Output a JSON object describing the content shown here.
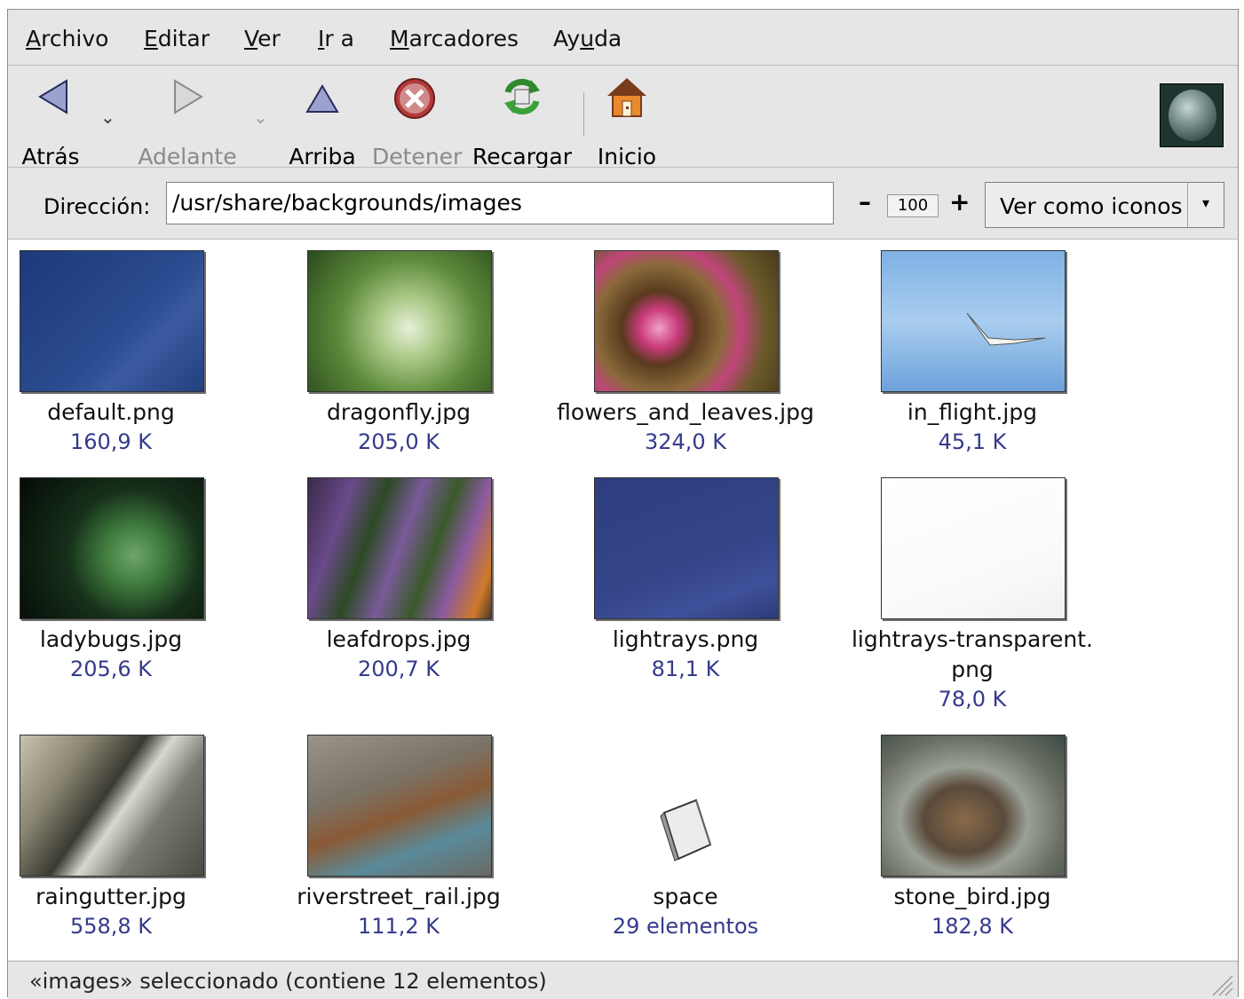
{
  "menu": {
    "items": [
      {
        "pre": "",
        "key": "A",
        "post": "rchivo"
      },
      {
        "pre": "",
        "key": "E",
        "post": "ditar"
      },
      {
        "pre": "",
        "key": "V",
        "post": "er"
      },
      {
        "pre": "",
        "key": "I",
        "post": "r a"
      },
      {
        "pre": "",
        "key": "M",
        "post": "arcadores"
      },
      {
        "pre": "Ay",
        "key": "u",
        "post": "da"
      }
    ]
  },
  "toolbar": {
    "back_label": "Atrás",
    "forward_label": "Adelante",
    "up_label": "Arriba",
    "stop_label": "Detener",
    "reload_label": "Recargar",
    "home_label": "Inicio"
  },
  "location": {
    "label": "Dirección:",
    "path": "/usr/share/backgrounds/images",
    "zoom": "100",
    "view_mode": "Ver como iconos"
  },
  "files": [
    {
      "name": "default.png",
      "size": "160,9 K"
    },
    {
      "name": "dragonfly.jpg",
      "size": "205,0 K"
    },
    {
      "name": "flowers_and_leaves.jpg",
      "size": "324,0 K"
    },
    {
      "name": "in_flight.jpg",
      "size": "45,1 K"
    },
    {
      "name": "ladybugs.jpg",
      "size": "205,6 K"
    },
    {
      "name": "leafdrops.jpg",
      "size": "200,7 K"
    },
    {
      "name": "lightrays.png",
      "size": "81,1 K"
    },
    {
      "name_line1": "lightrays-transparent.",
      "name_line2": "png",
      "size": "78,0 K"
    },
    {
      "name": "raingutter.jpg",
      "size": "558,8 K"
    },
    {
      "name": "riverstreet_rail.jpg",
      "size": "111,2 K"
    },
    {
      "name": "space",
      "size": "29 elementos"
    },
    {
      "name": "stone_bird.jpg",
      "size": "182,8 K"
    }
  ],
  "status": {
    "text": "«images» seleccionado (contiene 12 elementos)"
  }
}
